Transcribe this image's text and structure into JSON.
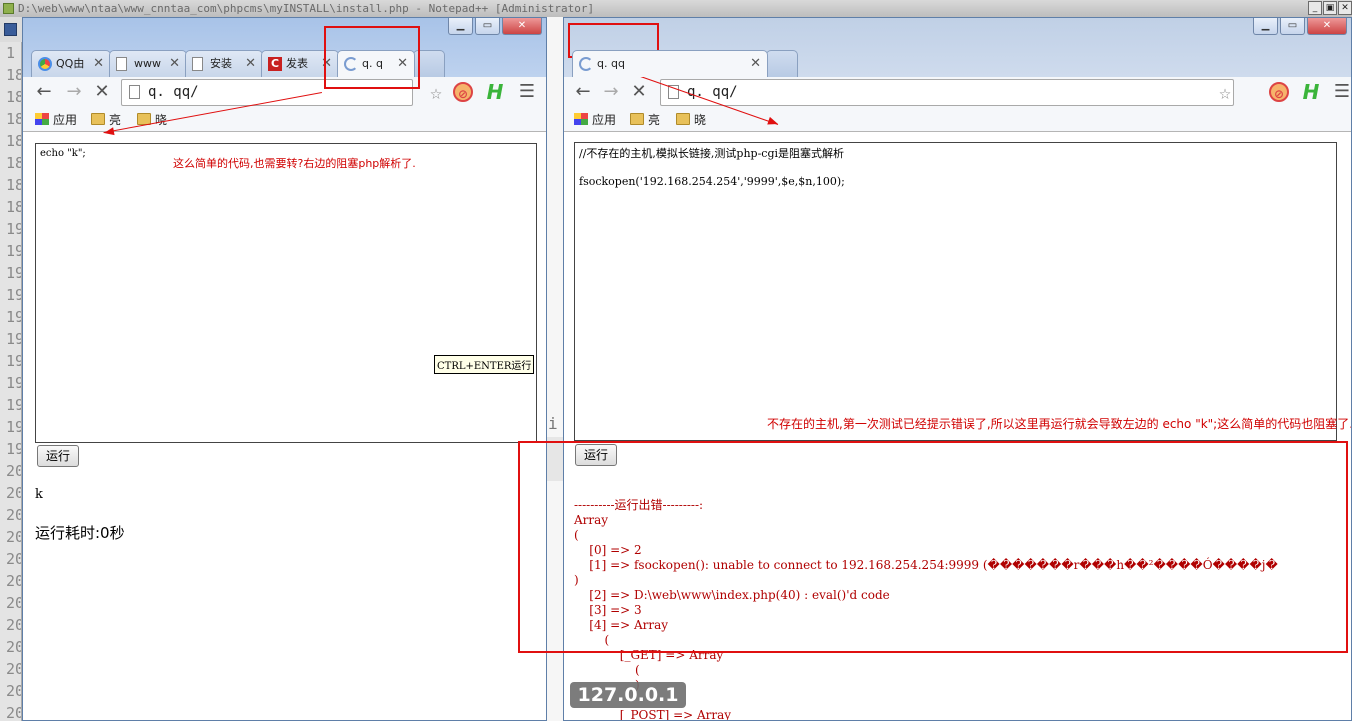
{
  "notepad": {
    "title": "D:\\web\\www\\ntaa\\www_cnntaa_com\\phpcms\\myINSTALL\\install.php - Notepad++ [Administrator]",
    "line_numbers": [
      "1",
      "18",
      "18",
      "18",
      "18",
      "18",
      "18",
      "18",
      "19",
      "19",
      "19",
      "19",
      "19",
      "19",
      "19",
      "19",
      "19",
      "19",
      "19",
      "20",
      "20",
      "20",
      "20",
      "20",
      "20",
      "20",
      "20",
      "20",
      "20",
      "20",
      "20",
      "2"
    ],
    "stray_text": "i"
  },
  "left_window": {
    "tabs": [
      {
        "label": "QQ由",
        "icon": "chrome-icon"
      },
      {
        "label": "www",
        "icon": "page-icon"
      },
      {
        "label": "安装",
        "icon": "page-icon"
      },
      {
        "label": "发表",
        "icon": "c-icon"
      },
      {
        "label": "q. q",
        "icon": "loading-icon"
      }
    ],
    "url": "q. qq/",
    "bookmarks": [
      "应用",
      "亮",
      "晓"
    ],
    "code": "echo \"k\";",
    "shortcut_hint": "CTRL+ENTER运行",
    "run_label": "运行",
    "output": "k",
    "runtime": "运行耗时:0秒",
    "annotation": "这么简单的代码,也需要转?右边的阻塞php解析了."
  },
  "right_window": {
    "tab_label": "q. qq",
    "url": "q. qq/",
    "bookmarks": [
      "应用",
      "亮",
      "晓"
    ],
    "code": "//不存在的主机,模拟长链接,测试php-cgi是阻塞式解析\n\nfsockopen('192.168.254.254','9999',$e,$n,100);",
    "run_label": "运行",
    "annotation": "不存在的主机,第一次测试已经提示错误了,所以这里再运行就会导致左边的 echo \"k\";这么简单的代码也阻塞了.",
    "output": "----------运行出错---------:\nArray\n(\n    [0] => 2\n    [1] => fsockopen(): unable to connect to 192.168.254.254:9999 (�������r���h��²����Ó����j�\n)\n    [2] => D:\\web\\www\\index.php(40) : eval()'d code\n    [3] => 3\n    [4] => Array\n        (\n            [_GET] => Array\n                (\n                )\n\n            [_POST] => Array\n                ("
  },
  "overlay": {
    "ip_badge": "127.0.0.1"
  },
  "colors": {
    "annotation_red": "#e01010",
    "output_red": "#b00000",
    "chrome_frame": "#a8c3e8"
  }
}
